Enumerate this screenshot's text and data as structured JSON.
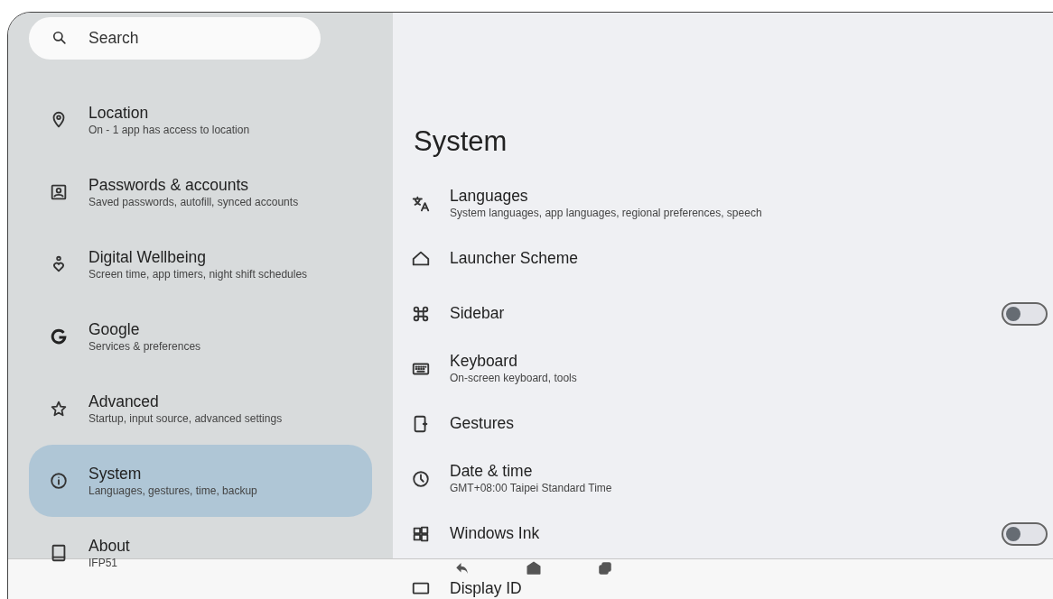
{
  "search": {
    "placeholder": "Search"
  },
  "sidebar": {
    "items": [
      {
        "title": "Location",
        "subtitle": "On - 1 app has access to location",
        "selected": false
      },
      {
        "title": "Passwords & accounts",
        "subtitle": "Saved passwords, autofill, synced accounts",
        "selected": false
      },
      {
        "title": "Digital Wellbeing",
        "subtitle": "Screen time, app timers, night shift schedules",
        "selected": false
      },
      {
        "title": "Google",
        "subtitle": "Services & preferences",
        "selected": false
      },
      {
        "title": "Advanced",
        "subtitle": "Startup, input source, advanced settings",
        "selected": false
      },
      {
        "title": "System",
        "subtitle": "Languages, gestures, time, backup",
        "selected": true
      },
      {
        "title": "About",
        "subtitle": "IFP51",
        "selected": false
      }
    ]
  },
  "page": {
    "title": "System",
    "rows": [
      {
        "kind": "link",
        "title": "Languages",
        "subtitle": "System languages, app languages, regional preferences, speech"
      },
      {
        "kind": "link",
        "title": "Launcher Scheme"
      },
      {
        "kind": "toggle",
        "title": "Sidebar",
        "on": false
      },
      {
        "kind": "link",
        "title": "Keyboard",
        "subtitle": "On-screen keyboard, tools"
      },
      {
        "kind": "link",
        "title": "Gestures"
      },
      {
        "kind": "link",
        "title": "Date & time",
        "subtitle": "GMT+08:00 Taipei Standard Time"
      },
      {
        "kind": "toggle",
        "title": "Windows Ink",
        "on": false
      },
      {
        "kind": "link",
        "title": "Display ID"
      }
    ]
  }
}
